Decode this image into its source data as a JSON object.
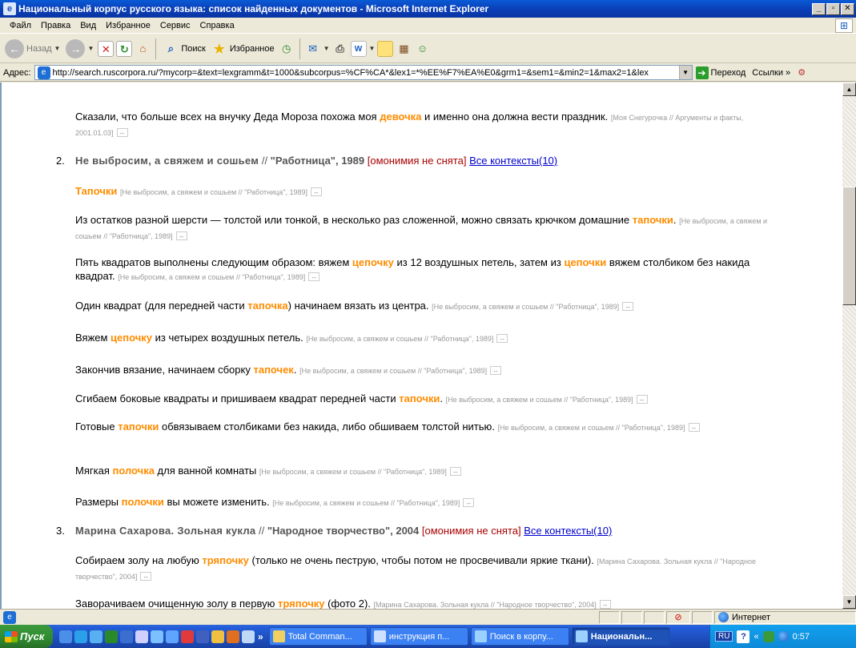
{
  "window": {
    "title": "Национальный корпус русского языка: список найденных документов - Microsoft Internet Explorer",
    "min": "_",
    "max": "▫",
    "close": "✕"
  },
  "menu": [
    "Файл",
    "Правка",
    "Вид",
    "Избранное",
    "Сервис",
    "Справка"
  ],
  "toolbar": {
    "back": "Назад",
    "search": "Поиск",
    "favorites": "Избранное"
  },
  "address": {
    "label": "Адрес:",
    "url": "http://search.ruscorpora.ru/?mycorp=&text=lexgramm&t=1000&subcorpus=%CF%CA*&lex1=*%EE%F7%EA%E0&grm1=&sem1=&min2=1&max2=1&lex",
    "go": "Переход",
    "links": "Ссылки"
  },
  "results": {
    "top_sentence": {
      "before": "Сказали, что больше всех на внучку Деда Мороза похожа моя ",
      "kw": "девочка",
      "after": " и именно она должна вести праздник.",
      "src": "[Моя Снегурочка // Аргументы и факты, 2001.01.03]"
    },
    "doc2": {
      "num": "2.",
      "title": "Не выбросим, а свяжем и сошьем",
      "sep": " // ",
      "source": "\"Работница\", 1989",
      "omonymy": "[омонимия не снята]",
      "contexts": "Все контексты(10)"
    },
    "doc2_sentences": [
      {
        "before": "",
        "kw": "Тапочки",
        "after": " ",
        "src": "[Не выбросим, а свяжем и сошьем // \"Работница\", 1989]"
      },
      {
        "before": "Из остатков разной шерсти — толстой или тонкой, в несколько раз сложенной, можно связать крючком домашние ",
        "kw": "тапочки",
        "after": ".",
        "src": "[Не выбросим, а свяжем и сошьем // \"Работница\", 1989]"
      },
      {
        "before": "Пять квадратов выполнены следующим образом: вяжем ",
        "kw": "цепочку",
        "after": " из 12 воздушных петель, затем из ",
        "kw2": "цепочки",
        "after2": " вяжем столбиком без накида квадрат.",
        "src": "[Не выбросим, а свяжем и сошьем // \"Работница\", 1989]"
      },
      {
        "before": "Один квадрат (для передней части ",
        "kw": "тапочка",
        "after": ") начинаем вязать из центра.",
        "src": "[Не выбросим, а свяжем и сошьем // \"Работница\", 1989]"
      },
      {
        "before": "Вяжем ",
        "kw": "цепочку",
        "after": " из четырех воздушных петель.",
        "src": "[Не выбросим, а свяжем и сошьем // \"Работница\", 1989]"
      },
      {
        "before": "Закончив вязание, начинаем сборку ",
        "kw": "тапочек",
        "after": ".",
        "src": "[Не выбросим, а свяжем и сошьем // \"Работница\", 1989]"
      },
      {
        "before": "Сгибаем боковые квадраты и пришиваем квадрат передней части ",
        "kw": "тапочки",
        "after": ".",
        "src": "[Не выбросим, а свяжем и сошьем // \"Работница\", 1989]"
      },
      {
        "before": "Готовые ",
        "kw": "тапочки",
        "after": " обвязываем столбиками без накида, либо обшиваем толстой нитью.",
        "src": "[Не выбросим, а свяжем и сошьем // \"Работница\", 1989]"
      },
      {
        "before": "Мягкая ",
        "kw": "полочка",
        "after": " для ванной комнаты",
        "src": "[Не выбросим, а свяжем и сошьем // \"Работница\", 1989]"
      },
      {
        "before": "Размеры ",
        "kw": "полочки",
        "after": " вы можете изменить.",
        "src": "[Не выбросим, а свяжем и сошьем // \"Работница\", 1989]"
      }
    ],
    "doc3": {
      "num": "3.",
      "title": "Марина Сахарова. Зольная кукла",
      "sep": " // ",
      "source": "\"Народное творчество\", 2004",
      "omonymy": "[омонимия не снята]",
      "contexts": "Все контексты(10)"
    },
    "doc3_sentences": [
      {
        "before": "Собираем золу на любую ",
        "kw": "тряпочку",
        "after": " (только не очень пеструю, чтобы потом не просвечивали яркие ткани).",
        "src": "[Марина Сахарова. Зольная кукла // \"Народное творчество\", 2004]"
      },
      {
        "before": "Заворачиваем очищенную золу в первую ",
        "kw": "тряпочку",
        "after": " (фото 2).",
        "src": "[Марина Сахарова. Зольная кукла // \"Народное творчество\", 2004]"
      }
    ],
    "expand_glyph": "↔"
  },
  "status": {
    "zone": "Интернет"
  },
  "taskbar": {
    "start": "Пуск",
    "more": "»",
    "tasks": [
      "Total Comman...",
      "инструкция п...",
      "Поиск в корпу...",
      "Национальн..."
    ],
    "lang": "RU",
    "tray_more": "«",
    "clock": "0:57"
  },
  "colors": {
    "keyword": "#ff8c00",
    "omonymy": "#aa0000",
    "link": "#0000cc",
    "titlebar": "#0a4fc4"
  }
}
